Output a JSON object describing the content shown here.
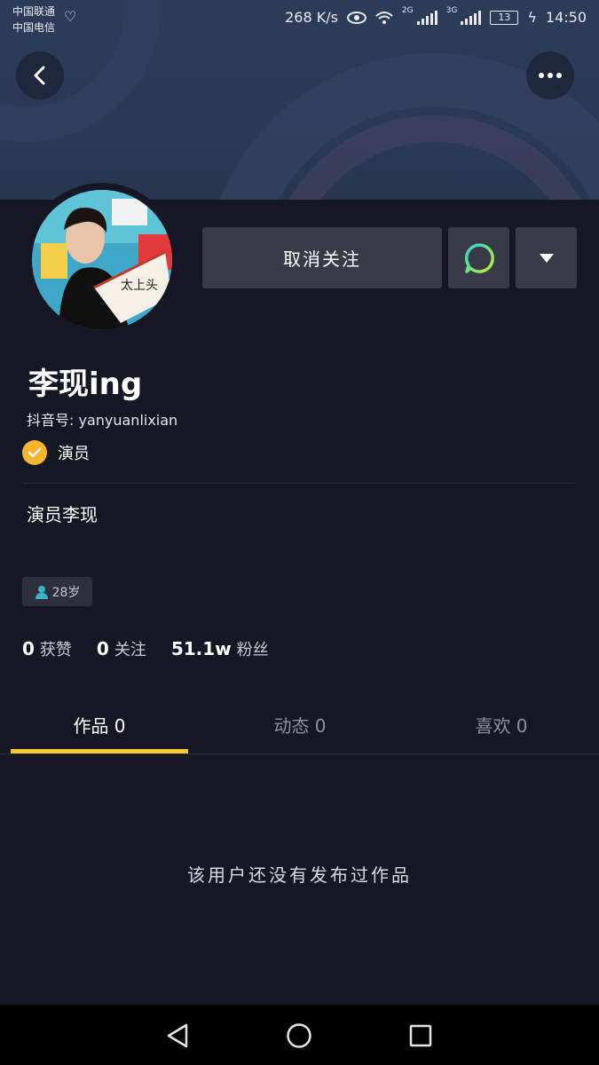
{
  "status_bar": {
    "carrier1": "中国联通",
    "carrier2": "中国电信",
    "net_speed": "268 K/s",
    "net_tag1": "2G",
    "net_tag2": "3G",
    "battery": "13",
    "time": "14:50"
  },
  "profile": {
    "name": "李现ing",
    "douyin_id": "抖音号: yanyuanlixian",
    "verification": "演员",
    "bio": "演员李现",
    "age": "28岁"
  },
  "actions": {
    "unfollow_label": "取消关注"
  },
  "stats": [
    {
      "value": "0",
      "label": "获赞"
    },
    {
      "value": "0",
      "label": "关注"
    },
    {
      "value": "51.1w",
      "label": "粉丝"
    }
  ],
  "tabs": [
    {
      "label": "作品 0"
    },
    {
      "label": "动态 0"
    },
    {
      "label": "喜欢 0"
    }
  ],
  "empty_message": "该用户还没有发布过作品",
  "colors": {
    "background": "#161724",
    "accent_yellow": "#f7c534",
    "verify_badge": "#f6b52d",
    "message_icon": "#35d6a8"
  }
}
